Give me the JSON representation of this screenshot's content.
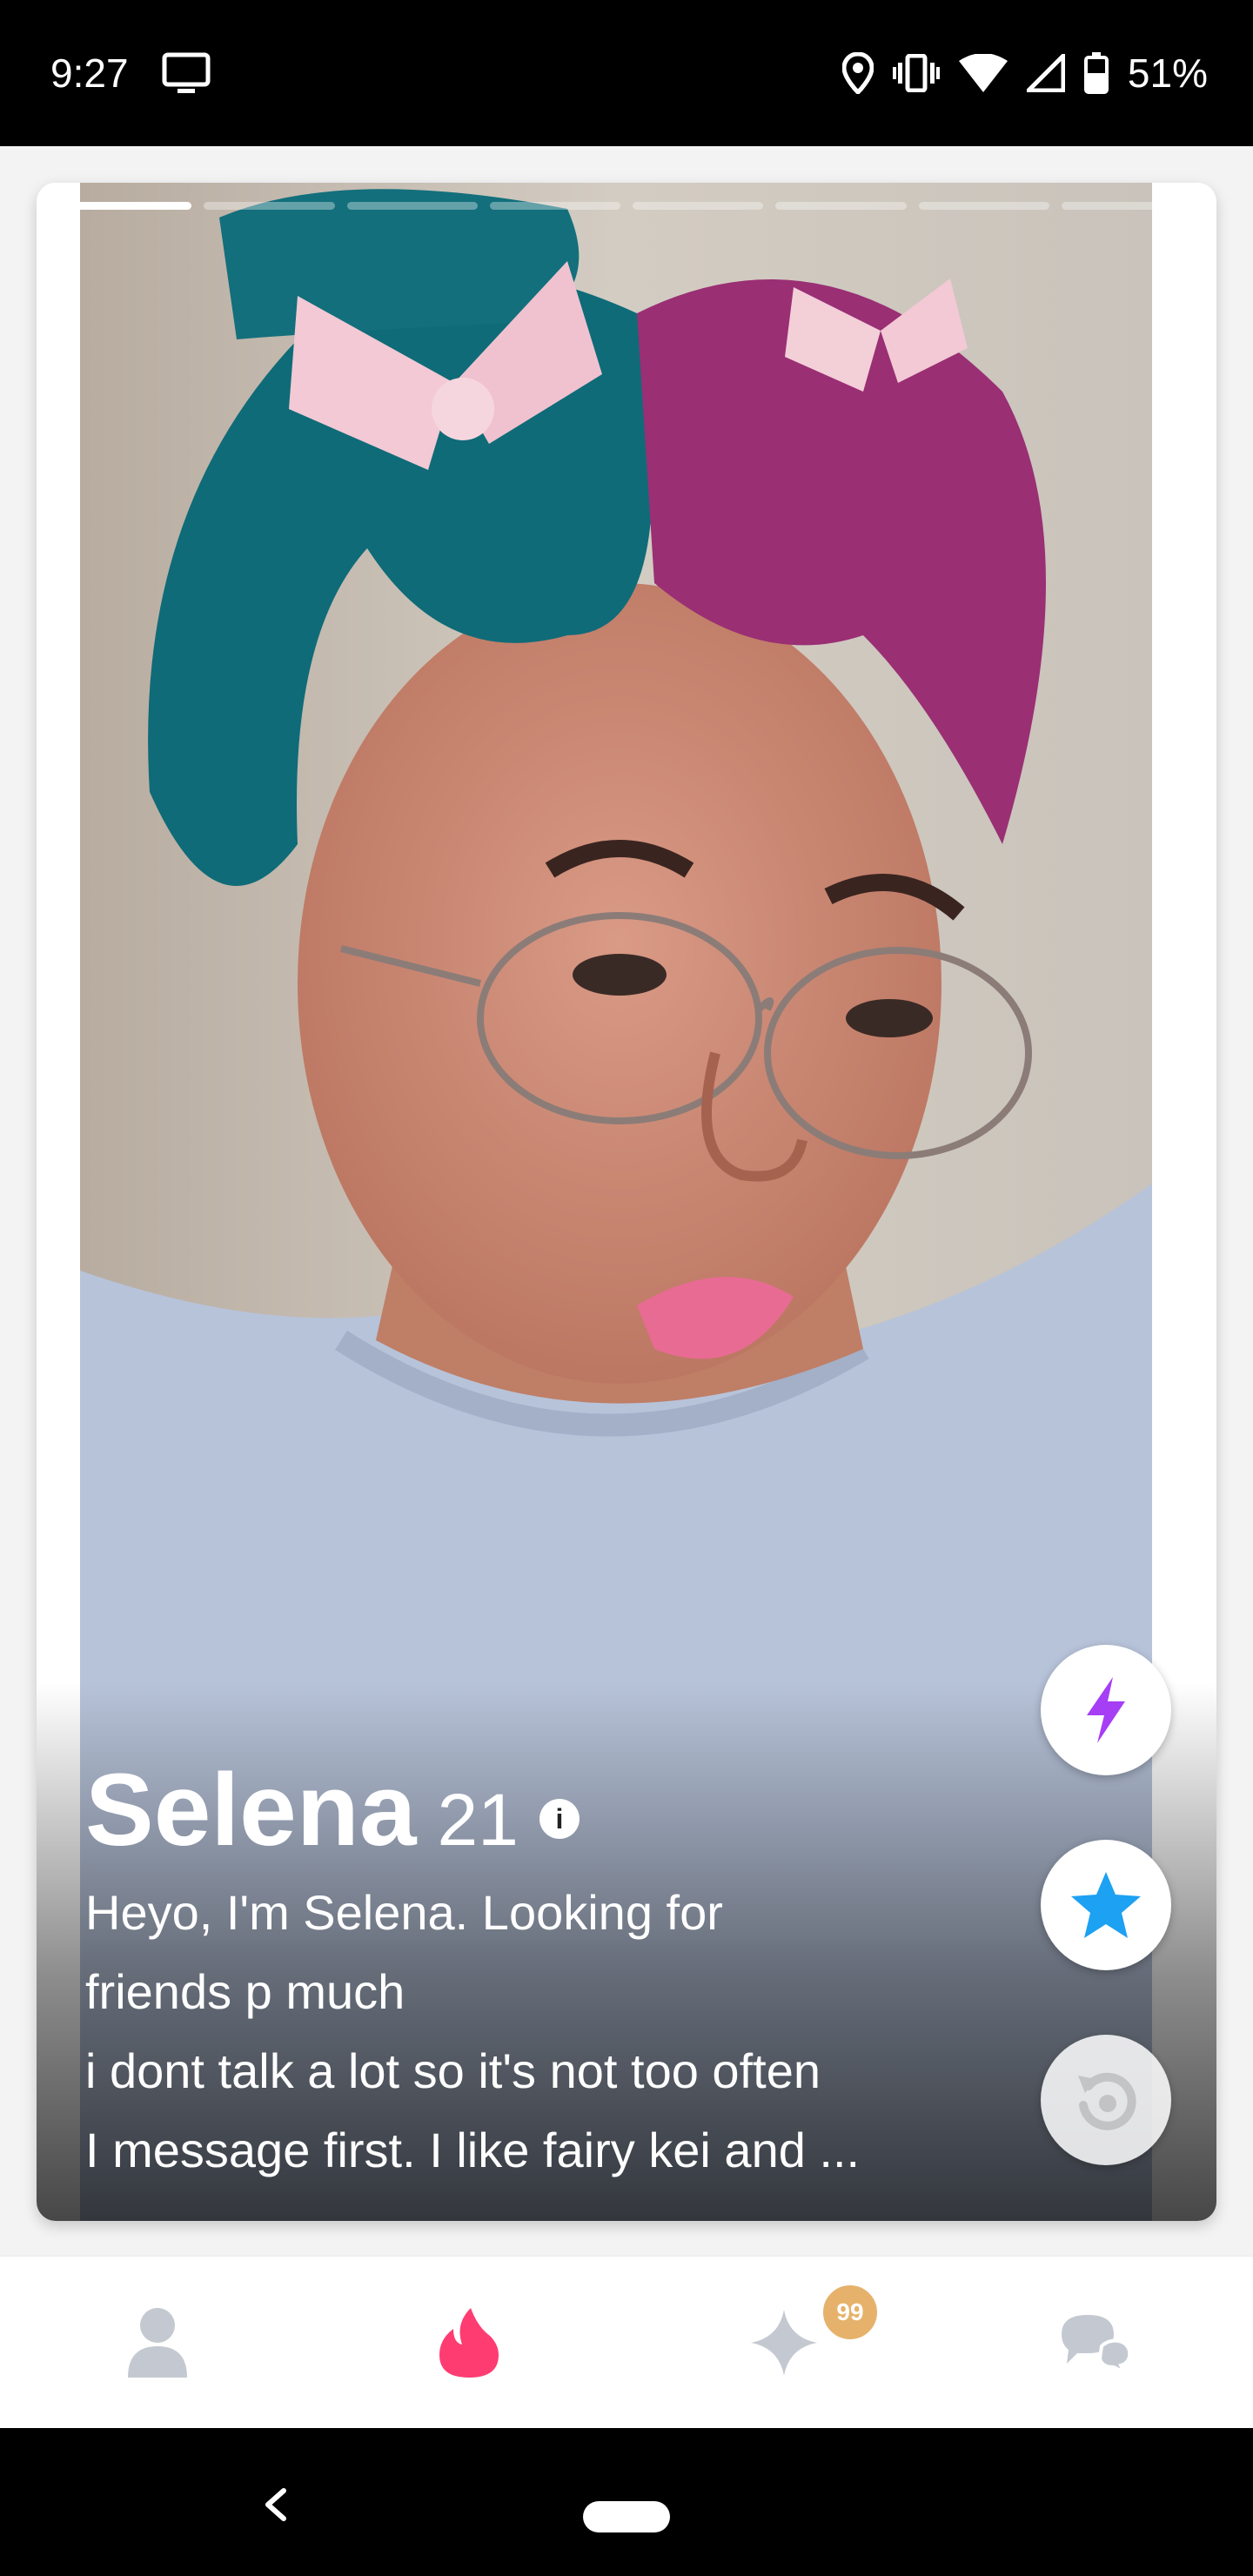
{
  "status_bar": {
    "time": "9:27",
    "battery": "51%",
    "icons": [
      "screen-cast-icon",
      "location-icon",
      "vibrate-icon",
      "wifi-icon",
      "signal-icon",
      "battery-icon"
    ]
  },
  "card": {
    "photo_count": 8,
    "active_photo": 1,
    "name": "Selena",
    "age": "21",
    "info_symbol": "i",
    "bio_lines": [
      "Heyo, I'm Selena. Looking for",
      "friends p much",
      "i dont talk a lot so it's not too often",
      "I message first. I like fairy kei and ..."
    ]
  },
  "actions": {
    "boost_color": "#a63ef5",
    "superlike_color": "#1da1f2",
    "rewind_color": "#d8d8d8"
  },
  "bottom_nav": {
    "items": [
      "profile-icon",
      "flame-icon",
      "sparkle-icon",
      "messages-icon"
    ],
    "likes_badge": "99",
    "active_color": "#fe3c72",
    "inactive_color": "#c4c9d1"
  }
}
